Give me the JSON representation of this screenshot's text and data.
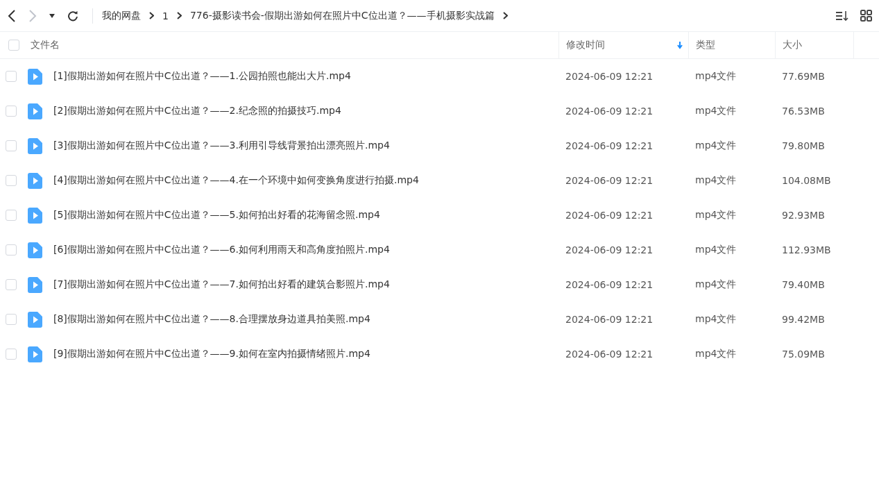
{
  "toolbar": {
    "back": {
      "disabled": false
    },
    "forward": {
      "disabled": true
    }
  },
  "breadcrumb": [
    "我的网盘",
    "1",
    "776-摄影读书会-假期出游如何在照片中C位出道？——手机摄影实战篇"
  ],
  "table": {
    "select_all": {
      "checked": false
    },
    "columns": [
      {
        "label": "文件名",
        "sorted": false
      },
      {
        "label": "修改时间",
        "sorted": true
      },
      {
        "label": "类型",
        "sorted": false
      },
      {
        "label": "大小",
        "sorted": false
      }
    ],
    "rows": [
      {
        "name": "[1]假期出游如何在照片中C位出道？——1.公园拍照也能出大片.mp4",
        "modified": "2024-06-09 12:21",
        "type": "mp4文件",
        "size": "77.69MB",
        "checked": false
      },
      {
        "name": "[2]假期出游如何在照片中C位出道？——2.纪念照的拍摄技巧.mp4",
        "modified": "2024-06-09 12:21",
        "type": "mp4文件",
        "size": "76.53MB",
        "checked": false
      },
      {
        "name": "[3]假期出游如何在照片中C位出道？——3.利用引导线背景拍出漂亮照片.mp4",
        "modified": "2024-06-09 12:21",
        "type": "mp4文件",
        "size": "79.80MB",
        "checked": false
      },
      {
        "name": "[4]假期出游如何在照片中C位出道？——4.在一个环境中如何变换角度进行拍摄.mp4",
        "modified": "2024-06-09 12:21",
        "type": "mp4文件",
        "size": "104.08MB",
        "checked": false
      },
      {
        "name": "[5]假期出游如何在照片中C位出道？——5.如何拍出好看的花海留念照.mp4",
        "modified": "2024-06-09 12:21",
        "type": "mp4文件",
        "size": "92.93MB",
        "checked": false
      },
      {
        "name": "[6]假期出游如何在照片中C位出道？——6.如何利用雨天和高角度拍照片.mp4",
        "modified": "2024-06-09 12:21",
        "type": "mp4文件",
        "size": "112.93MB",
        "checked": false
      },
      {
        "name": "[7]假期出游如何在照片中C位出道？——7.如何拍出好看的建筑合影照片.mp4",
        "modified": "2024-06-09 12:21",
        "type": "mp4文件",
        "size": "79.40MB",
        "checked": false
      },
      {
        "name": "[8]假期出游如何在照片中C位出道？——8.合理摆放身边道具拍美照.mp4",
        "modified": "2024-06-09 12:21",
        "type": "mp4文件",
        "size": "99.42MB",
        "checked": false
      },
      {
        "name": "[9]假期出游如何在照片中C位出道？——9.如何在室内拍摄情绪照片.mp4",
        "modified": "2024-06-09 12:21",
        "type": "mp4文件",
        "size": "75.09MB",
        "checked": false
      }
    ]
  }
}
